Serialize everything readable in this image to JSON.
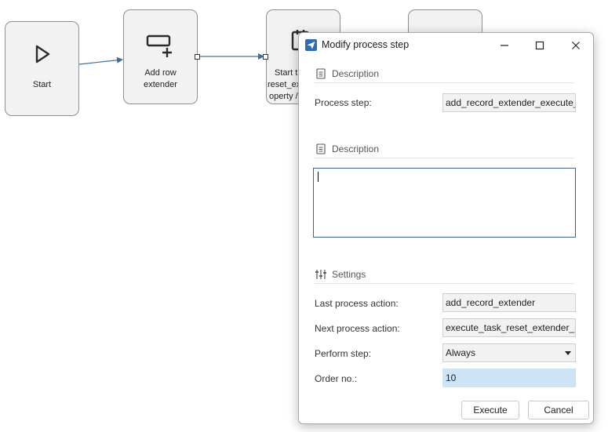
{
  "canvas": {
    "nodes": [
      {
        "id": "start",
        "icon": "play-icon",
        "label": "Start"
      },
      {
        "id": "add_row_extender",
        "icon": "add-row-icon",
        "label_lines": [
          "Add row",
          "extender"
        ]
      },
      {
        "id": "start_task",
        "icon": "task-clipboard-icon",
        "label_lines": [
          "Start t",
          "reset_ex",
          "operty /"
        ]
      },
      {
        "id": "hidden_node",
        "icon": "",
        "label": ""
      }
    ]
  },
  "dialog": {
    "title": "Modify process step",
    "app_icon": "paper-plane-icon",
    "controls": {
      "minimize": "minimize-icon",
      "maximize": "maximize-icon",
      "close": "close-icon"
    },
    "section1": {
      "title": "Description",
      "icon": "document-icon"
    },
    "process_step": {
      "label": "Process step:",
      "value": "add_record_extender_execute_ta"
    },
    "section2": {
      "title": "Description",
      "icon": "document-icon"
    },
    "description": {
      "value": ""
    },
    "section3": {
      "title": "Settings",
      "icon": "sliders-icon"
    },
    "last_action": {
      "label": "Last process action:",
      "value": "add_record_extender"
    },
    "next_action": {
      "label": "Next process action:",
      "value": "execute_task_reset_extender_pro"
    },
    "perform_step": {
      "label": "Perform step:",
      "value": "Always"
    },
    "order_no": {
      "label": "Order no.:",
      "value": "10"
    },
    "buttons": {
      "execute": "Execute",
      "cancel": "Cancel"
    }
  }
}
